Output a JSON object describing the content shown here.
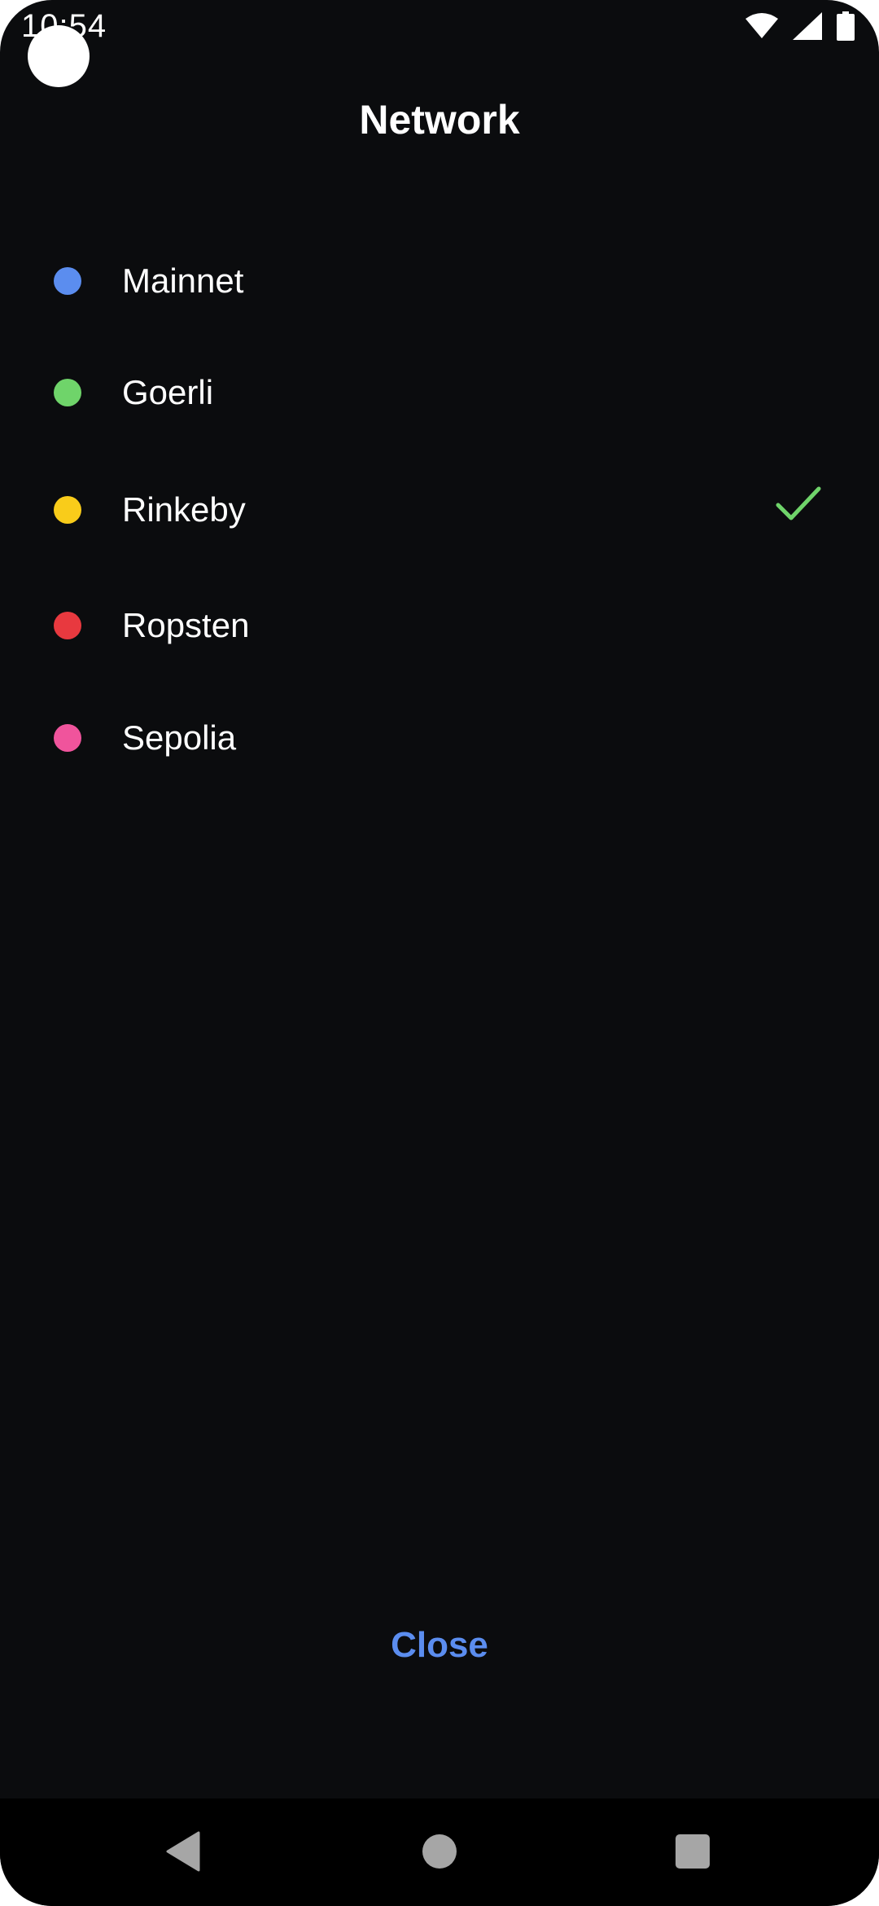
{
  "status_bar": {
    "time": "10:54",
    "icons": [
      "wifi-icon",
      "signal-icon",
      "battery-icon"
    ]
  },
  "header": {
    "title": "Network"
  },
  "networks": [
    {
      "label": "Mainnet",
      "color": "#5b8def",
      "selected": false
    },
    {
      "label": "Goerli",
      "color": "#6fd46a",
      "selected": false
    },
    {
      "label": "Rinkeby",
      "color": "#f9cc1a",
      "selected": true
    },
    {
      "label": "Ropsten",
      "color": "#e8393f",
      "selected": false
    },
    {
      "label": "Sepolia",
      "color": "#f0549c",
      "selected": false
    }
  ],
  "actions": {
    "close_label": "Close"
  },
  "colors": {
    "background": "#0b0c0e",
    "accent": "#5b8def",
    "check": "#6fd46a"
  },
  "nav_bar": {
    "buttons": [
      "back-icon",
      "home-icon",
      "recents-icon"
    ]
  }
}
